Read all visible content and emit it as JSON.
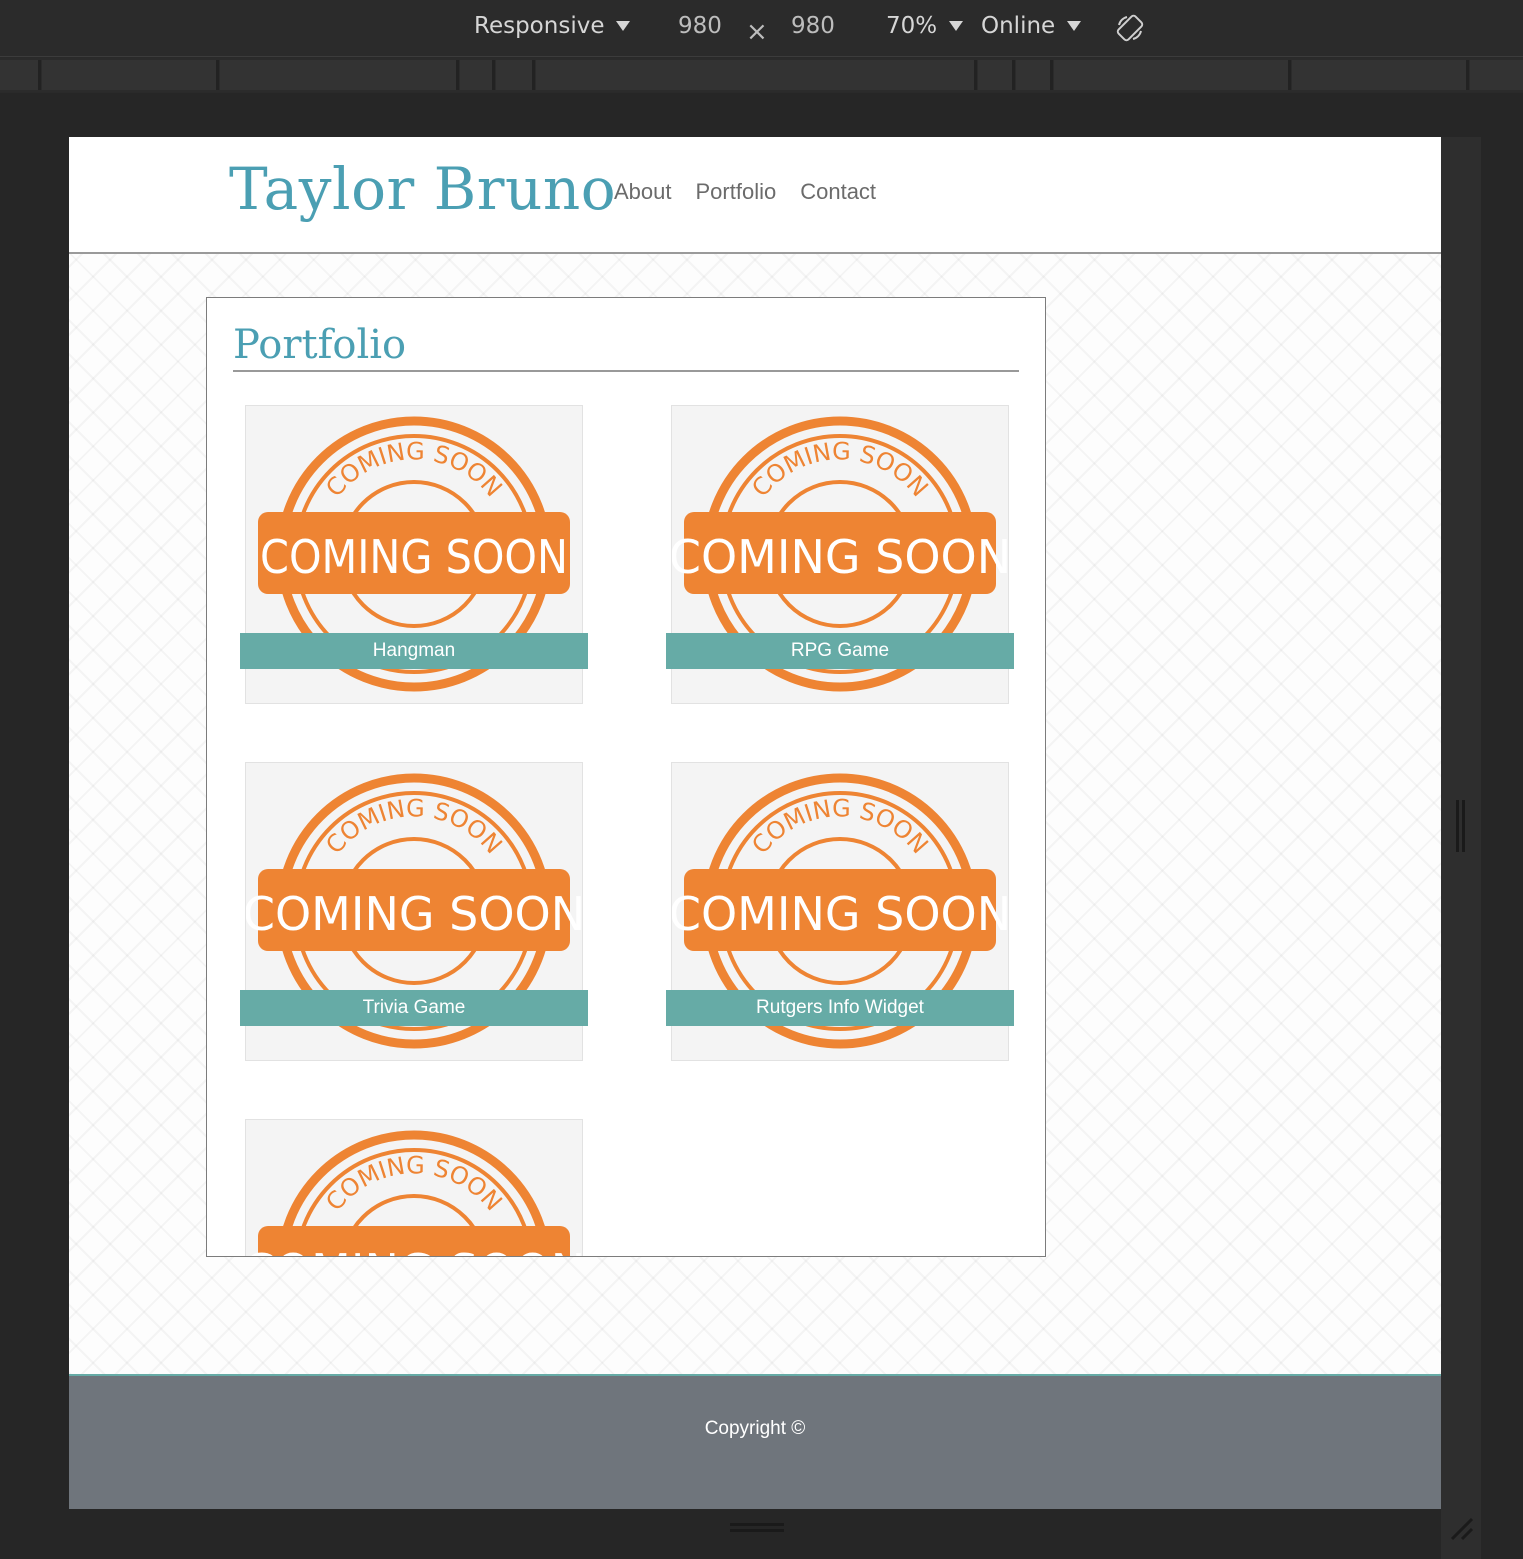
{
  "devtools": {
    "device": "Responsive",
    "width": "980",
    "times": "×",
    "height": "980",
    "zoom": "70%",
    "network": "Online"
  },
  "site": {
    "brand": "Taylor Bruno",
    "nav": [
      "About",
      "Portfolio",
      "Contact"
    ],
    "section_title": "Portfolio",
    "placeholder_text_top": "COMING SOON",
    "placeholder_text_main": "COMING SOON",
    "projects": [
      "Hangman",
      "RPG Game",
      "Trivia Game",
      "Rutgers Info Widget"
    ],
    "footer": "Copyright ©"
  },
  "colors": {
    "brand": "#4b9fb3",
    "caption_bg": "#66aba6",
    "stamp": "#ee8433",
    "footer_bg": "#6f757c"
  }
}
